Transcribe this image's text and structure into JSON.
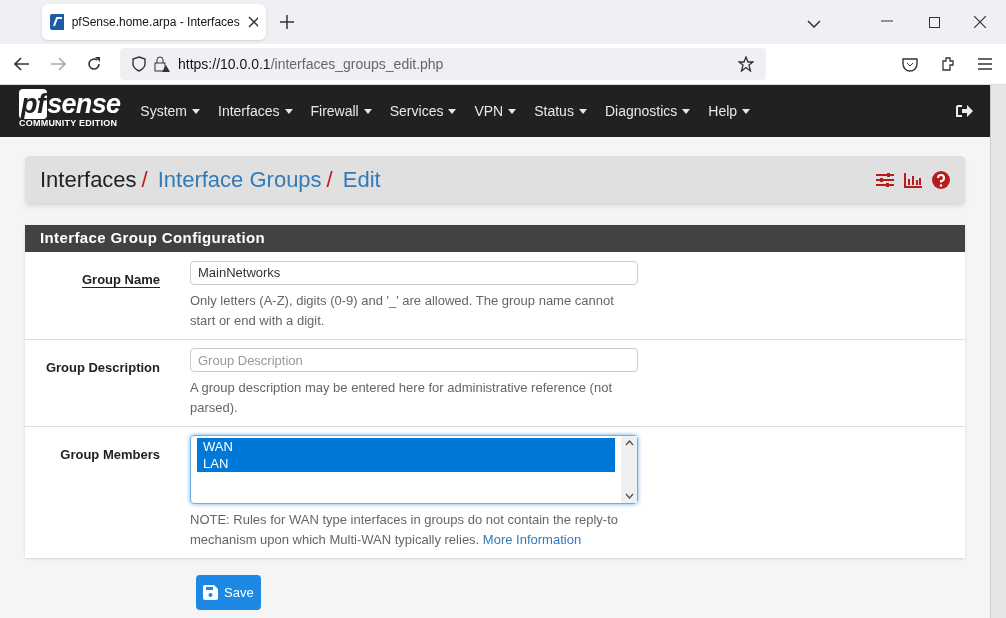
{
  "browser": {
    "tab_title": "pfSense.home.arpa - Interfaces",
    "url_host": "https://10.0.0.1",
    "url_path": "/interfaces_groups_edit.php"
  },
  "navbar": {
    "logo": {
      "name": "sense",
      "prefix": "pf",
      "edition": "COMMUNITY EDITION"
    },
    "menu": [
      "System",
      "Interfaces",
      "Firewall",
      "Services",
      "VPN",
      "Status",
      "Diagnostics",
      "Help"
    ]
  },
  "breadcrumb": [
    {
      "label": "Interfaces",
      "link": false,
      "separator": "/"
    },
    {
      "label": "Interface Groups",
      "link": true,
      "separator": "/"
    },
    {
      "label": "Edit",
      "link": true
    }
  ],
  "panel": {
    "title": "Interface Group Configuration",
    "rows": [
      {
        "kind": "text",
        "label": "Group Name",
        "underlined": true,
        "value": "MainNetworks",
        "help": "Only letters (A-Z), digits (0-9) and '_' are allowed. The group name cannot start or end with a digit."
      },
      {
        "kind": "text",
        "label": "Group Description",
        "underlined": false,
        "placeholder": "Group Description",
        "help": "A group description may be entered here for administrative reference (not parsed)."
      },
      {
        "kind": "list",
        "label": "Group Members",
        "underlined": false,
        "options": [
          {
            "label": "WAN",
            "selected": true
          },
          {
            "label": "LAN",
            "selected": true
          }
        ],
        "help": "NOTE: Rules for WAN type interfaces in groups do not contain the reply-to mechanism upon which Multi-WAN typically relies.",
        "help_link": "More Information"
      }
    ]
  },
  "save_button": "Save"
}
